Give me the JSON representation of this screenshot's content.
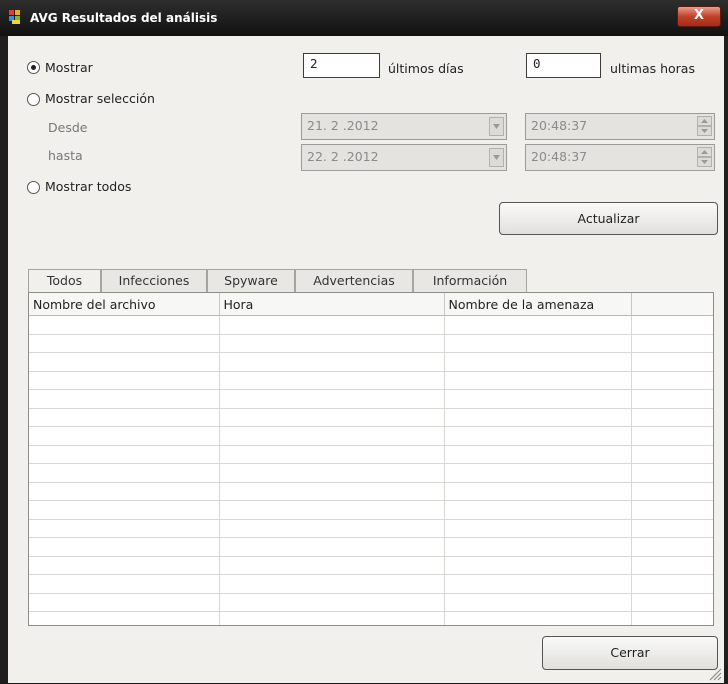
{
  "window": {
    "title": "AVG Resultados del análisis",
    "close_label": "X"
  },
  "filters": {
    "show_last": {
      "label": "Mostrar",
      "selected": true
    },
    "days": {
      "value": "2",
      "label": "últimos días"
    },
    "hours": {
      "value": "0",
      "label": "ultimas horas"
    },
    "show_selection": {
      "label": "Mostrar selección",
      "selected": false
    },
    "from": {
      "label": "Desde",
      "date": "21. 2 .2012",
      "time": "20:48:37"
    },
    "to": {
      "label": "hasta",
      "date": "22. 2 .2012",
      "time": "20:48:37"
    },
    "show_all": {
      "label": "Mostrar todos",
      "selected": false
    },
    "refresh_label": "Actualizar"
  },
  "tabs": [
    {
      "label": "Todos",
      "active": true
    },
    {
      "label": "Infecciones",
      "active": false
    },
    {
      "label": "Spyware",
      "active": false
    },
    {
      "label": "Advertencias",
      "active": false
    },
    {
      "label": "Información",
      "active": false
    }
  ],
  "results_table": {
    "columns": [
      "Nombre del archivo",
      "Hora",
      "Nombre de la amenaza",
      ""
    ],
    "rows": []
  },
  "close_button_label": "Cerrar",
  "colors": {
    "title_bar": "#111111",
    "close_button": "#c0412a",
    "window_bg": "#f1f0ec"
  }
}
